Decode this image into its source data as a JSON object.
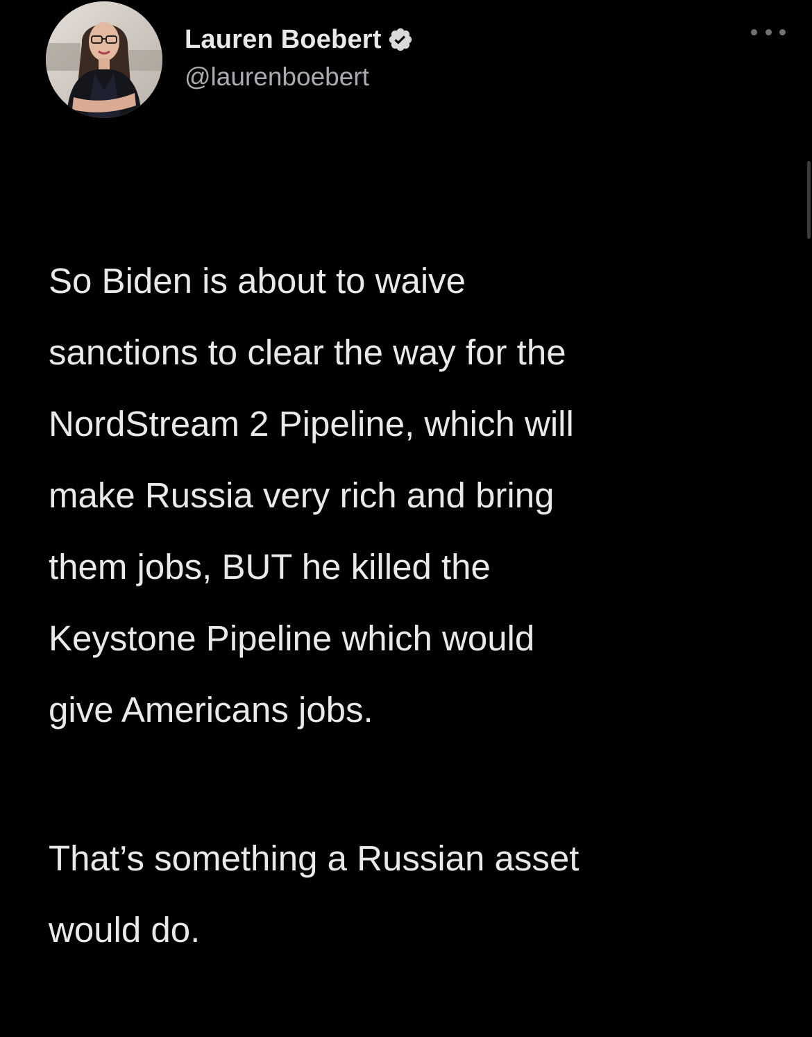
{
  "tweet": {
    "author": {
      "display_name": "Lauren Boebert",
      "handle": "@laurenboebert",
      "verified": true,
      "verified_color": "#d9d9d9"
    },
    "menu_icon": "more-horizontal-icon",
    "paragraphs": [
      "So Biden is about to waive\nsanctions to clear the way for the\nNordStream 2 Pipeline, which will\nmake Russia very rich and bring\nthem jobs, BUT he killed the\nKeystone Pipeline which would\ngive Americans jobs.",
      "That’s something a Russian asset\nwould do."
    ]
  },
  "theme": {
    "background": "#000000",
    "text": "#e7e9ea",
    "secondary_text": "#a8acb0"
  }
}
